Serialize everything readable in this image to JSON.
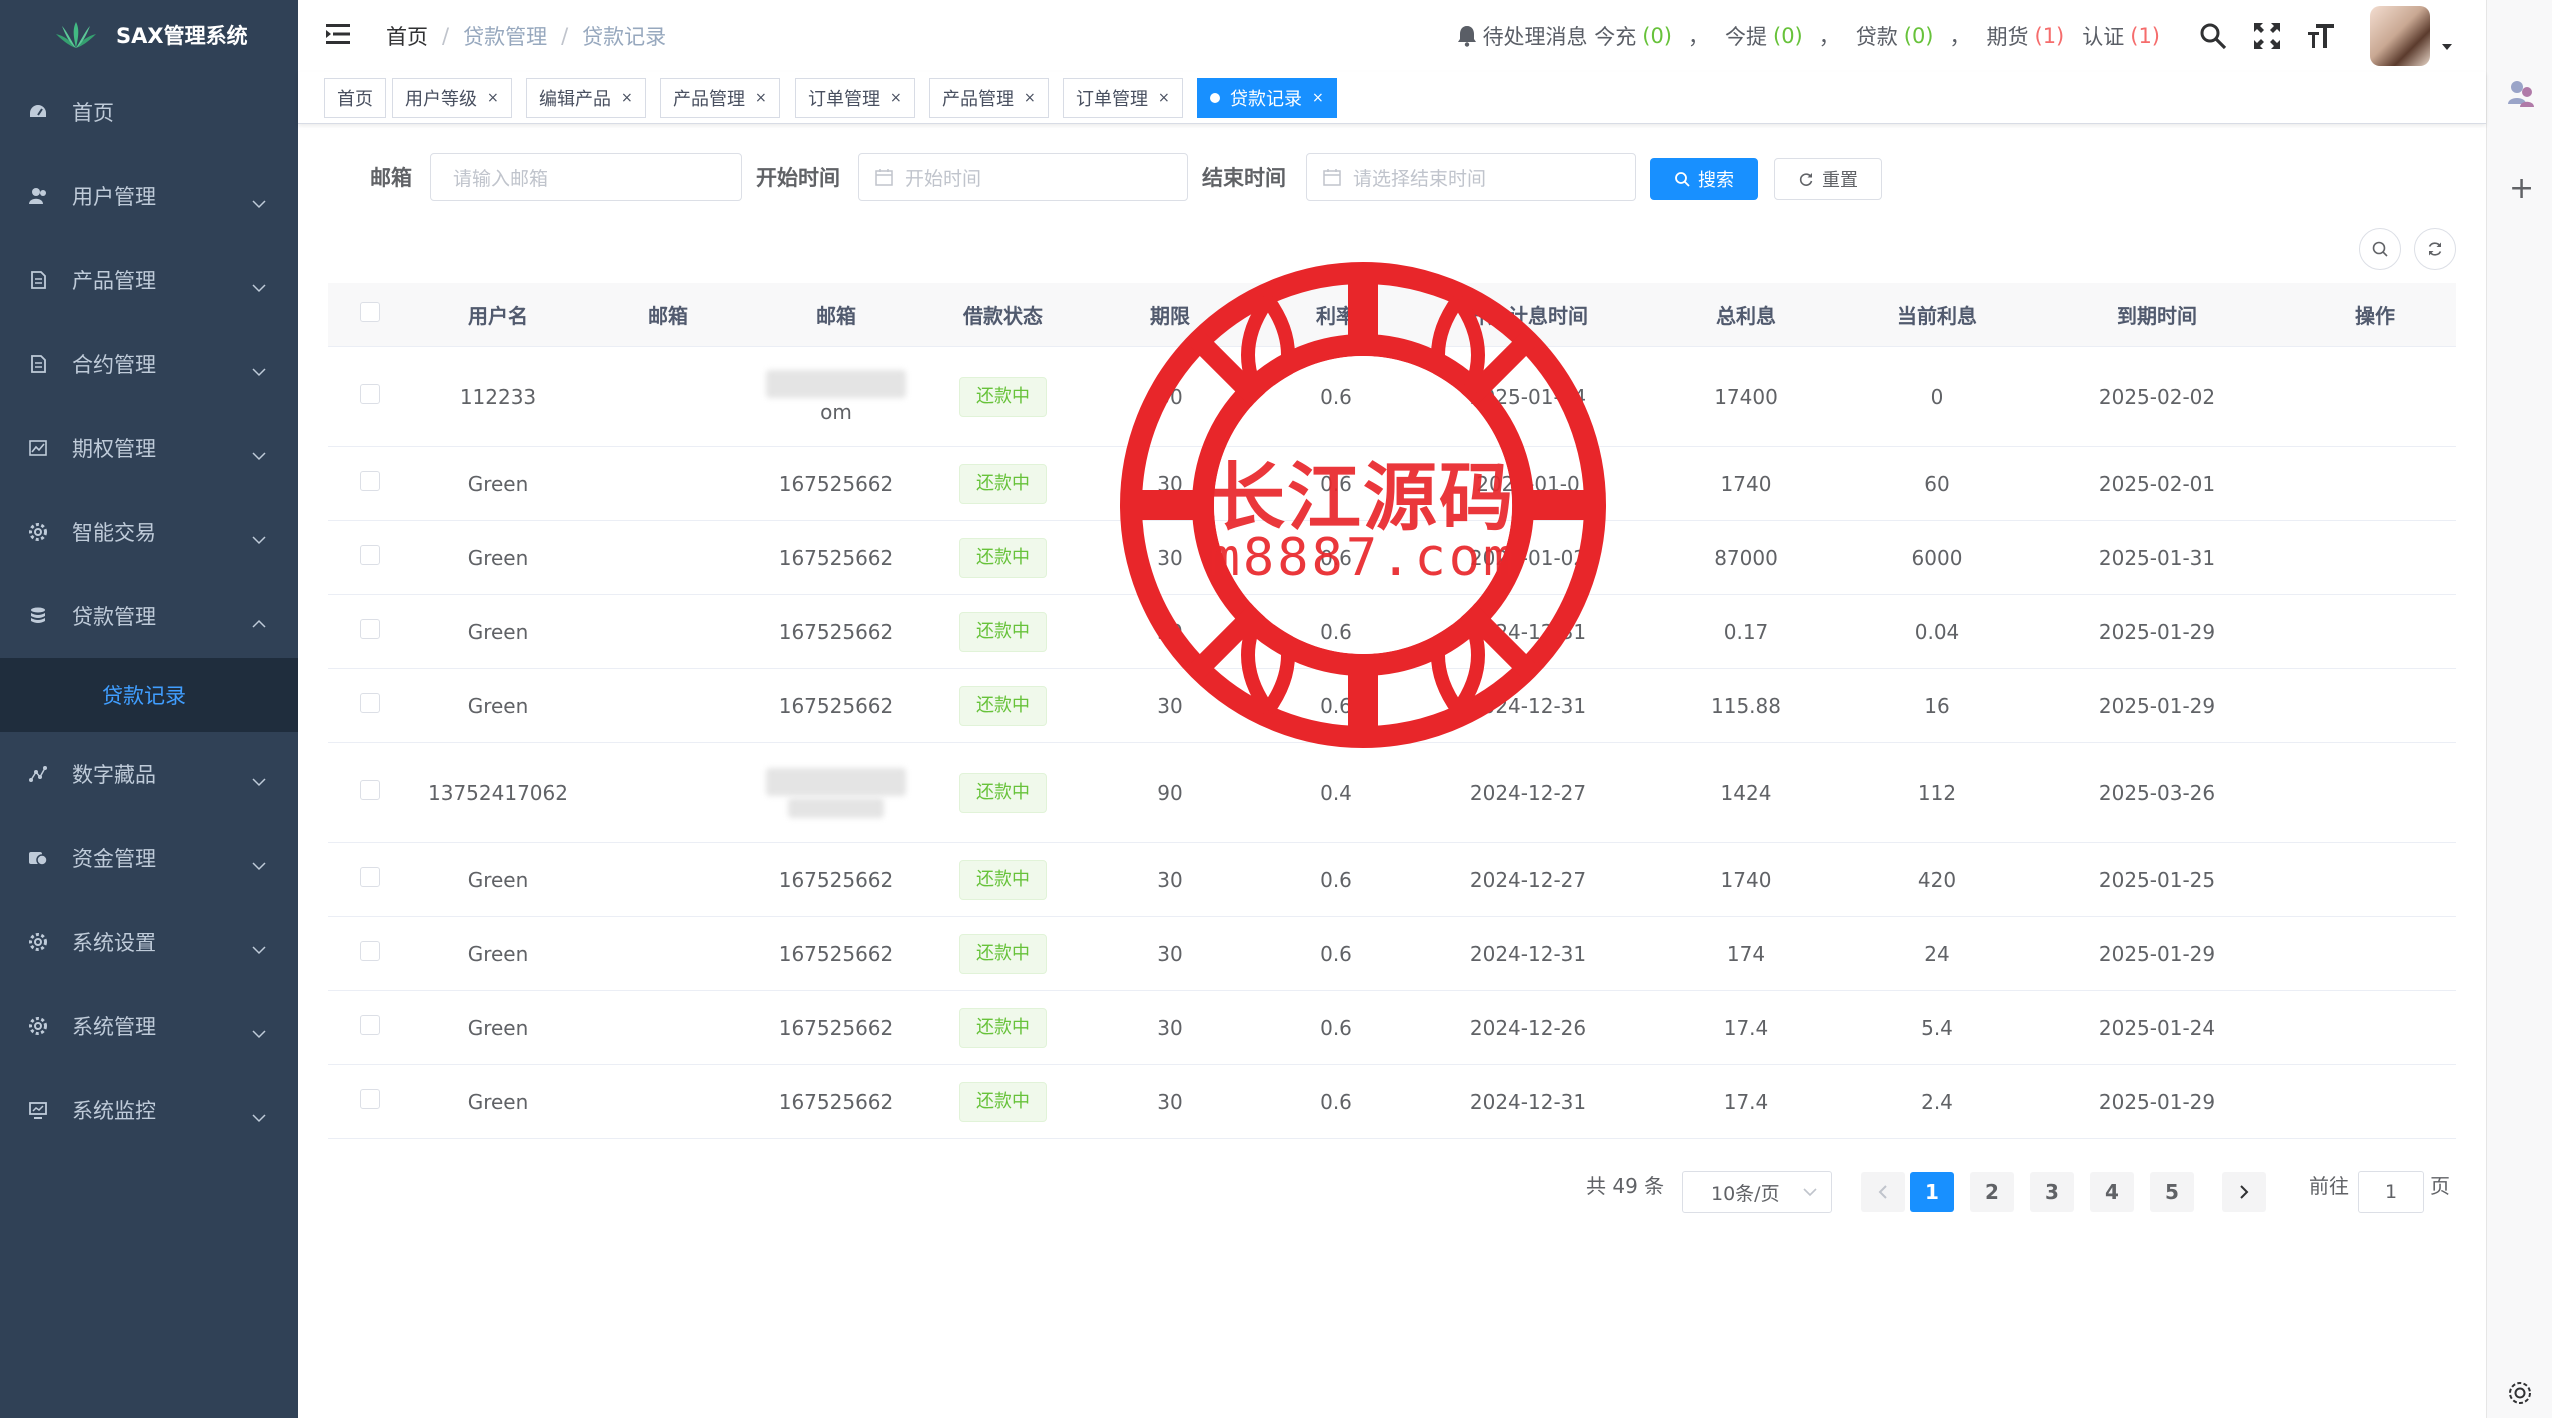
{
  "app": {
    "title": "SAX管理系统"
  },
  "sidebar": {
    "items": [
      {
        "label": "首页",
        "icon": "dashboard-icon"
      },
      {
        "label": "用户管理",
        "icon": "user-icon"
      },
      {
        "label": "产品管理",
        "icon": "document-icon"
      },
      {
        "label": "合约管理",
        "icon": "document-icon"
      },
      {
        "label": "期权管理",
        "icon": "chart-icon"
      },
      {
        "label": "智能交易",
        "icon": "gear-icon"
      },
      {
        "label": "贷款管理",
        "icon": "database-icon"
      },
      {
        "label": "数字藏品",
        "icon": "graph-icon"
      },
      {
        "label": "资金管理",
        "icon": "money-icon"
      },
      {
        "label": "系统设置",
        "icon": "gear-icon"
      },
      {
        "label": "系统管理",
        "icon": "gear-icon"
      },
      {
        "label": "系统监控",
        "icon": "monitor-icon"
      }
    ],
    "active_sub": "贷款记录"
  },
  "breadcrumb": {
    "home": "首页",
    "parent": "贷款管理",
    "current": "贷款记录"
  },
  "header": {
    "msg_label": "待处理消息 今充",
    "recharge_count": "(0)",
    "withdraw_label": "今提",
    "withdraw_count": "(0)",
    "loan_label": "贷款",
    "loan_count": "(0)",
    "futures_label": "期货",
    "futures_count": "(1)",
    "auth_label": "认证",
    "auth_count": "(1)",
    "comma": "，"
  },
  "tags": [
    "首页",
    "用户等级",
    "编辑产品",
    "产品管理",
    "订单管理",
    "产品管理",
    "订单管理",
    "贷款记录"
  ],
  "search": {
    "email_label": "邮箱",
    "email_placeholder": "请输入邮箱",
    "start_label": "开始时间",
    "start_placeholder": "开始时间",
    "end_label": "结束时间",
    "end_placeholder": "请选择结束时间",
    "search_btn": "搜索",
    "reset_btn": "重置"
  },
  "table": {
    "columns": [
      "用户名",
      "邮箱",
      "邮箱",
      "借款状态",
      "期限",
      "利率",
      "开始计息时间",
      "总利息",
      "当前利息",
      "到期时间",
      "操作"
    ],
    "rows": [
      {
        "username": "112233",
        "email2": "om",
        "status": "还款中",
        "term": "30",
        "rate": "0.6",
        "start": "2025-01-04",
        "total": "17400",
        "current": "0",
        "due": "2025-02-02"
      },
      {
        "username": "Green",
        "email2": "167525662",
        "status": "还款中",
        "term": "30",
        "rate": "0.6",
        "start": "2025-01-0",
        "total": "1740",
        "current": "60",
        "due": "2025-02-01"
      },
      {
        "username": "Green",
        "email2": "167525662",
        "status": "还款中",
        "term": "30",
        "rate": "0.6",
        "start": "2025-01-02",
        "total": "87000",
        "current": "6000",
        "due": "2025-01-31"
      },
      {
        "username": "Green",
        "email2": "167525662",
        "status": "还款中",
        "term": "30",
        "rate": "0.6",
        "start": "2024-12-31",
        "total": "0.17",
        "current": "0.04",
        "due": "2025-01-29"
      },
      {
        "username": "Green",
        "email2": "167525662",
        "status": "还款中",
        "term": "30",
        "rate": "0.6",
        "start": "2024-12-31",
        "total": "115.88",
        "current": "16",
        "due": "2025-01-29"
      },
      {
        "username": "13752417062",
        "email2": "",
        "status": "还款中",
        "term": "90",
        "rate": "0.4",
        "start": "2024-12-27",
        "total": "1424",
        "current": "112",
        "due": "2025-03-26"
      },
      {
        "username": "Green",
        "email2": "167525662",
        "status": "还款中",
        "term": "30",
        "rate": "0.6",
        "start": "2024-12-27",
        "total": "1740",
        "current": "420",
        "due": "2025-01-25"
      },
      {
        "username": "Green",
        "email2": "167525662",
        "status": "还款中",
        "term": "30",
        "rate": "0.6",
        "start": "2024-12-31",
        "total": "174",
        "current": "24",
        "due": "2025-01-29"
      },
      {
        "username": "Green",
        "email2": "167525662",
        "status": "还款中",
        "term": "30",
        "rate": "0.6",
        "start": "2024-12-26",
        "total": "17.4",
        "current": "5.4",
        "due": "2025-01-24"
      },
      {
        "username": "Green",
        "email2": "167525662",
        "status": "还款中",
        "term": "30",
        "rate": "0.6",
        "start": "2024-12-31",
        "total": "17.4",
        "current": "2.4",
        "due": "2025-01-29"
      }
    ]
  },
  "pagination": {
    "total_text": "共 49 条",
    "page_size": "10条/页",
    "pages": [
      "1",
      "2",
      "3",
      "4",
      "5"
    ],
    "current_page": "1",
    "goto_label": "前往",
    "goto_value": "1",
    "page_suffix": "页"
  },
  "watermark": {
    "line1": "长江源码",
    "line2": "m8887.com"
  },
  "colors": {
    "sidebar_bg": "#304156",
    "accent": "#1890ff",
    "success": "#67c23a",
    "danger": "#f56c6c",
    "seal_red": "#e8262a"
  }
}
